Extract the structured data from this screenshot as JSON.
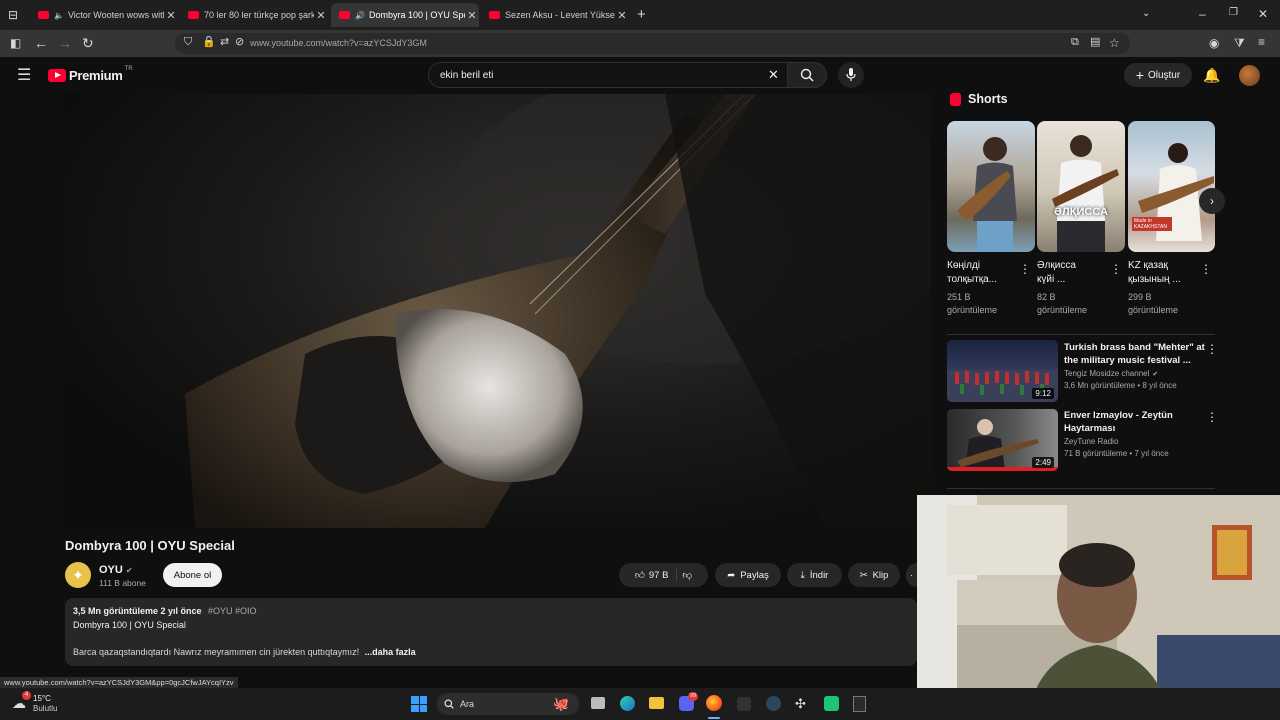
{
  "browser": {
    "tabs": [
      {
        "title": "Victor Wooten wows with h",
        "active": false,
        "audio": true
      },
      {
        "title": "70 ler 80 ler türkçe pop şarkıları",
        "active": false,
        "audio": false
      },
      {
        "title": "Dombyra 100 | OYU Special",
        "active": true,
        "audio": true
      },
      {
        "title": "Sezen Aksu - Levent Yüksel - Se",
        "active": false,
        "audio": false
      }
    ],
    "new_tab_label": "+",
    "url": "www.youtube.com/watch?v=azYCSJdY3GM",
    "status_url": "www.youtube.com/watch?v=azYCSJdY3GM&pp=0gcJCfwJAYcqIYzv"
  },
  "youtube": {
    "logo_text": "Premium",
    "logo_badge": "TR",
    "search_value": "ekin beril eti",
    "create_label": "Oluştur"
  },
  "video": {
    "title": "Dombyra 100 | OYU Special",
    "channel_name": "OYU",
    "subscribers": "111 B abone",
    "subscribe_label": "Abone ol",
    "likes": "97 B",
    "share_label": "Paylaş",
    "download_label": "İndir",
    "clip_label": "Klip",
    "description": {
      "meta": "3,5 Mn görüntüleme  2 yıl önce",
      "tags": "#OYU #OIO",
      "line1": "Dombyra 100 | OYU Special",
      "line2": "Barca qazaqstandıqtardı Nawrız meyramımen cin jürekten quttıqtaymız!",
      "more": "...daha fazla"
    }
  },
  "sidebar": {
    "shorts_heading": "Shorts",
    "shorts": [
      {
        "title_line1": "Көңілді",
        "title_line2": "толқытқа...",
        "views_line1": "251 B",
        "views_line2": "görüntüleme",
        "overlay": ""
      },
      {
        "title_line1": "Әлқисса",
        "title_line2": "күйі ...",
        "views_line1": "82 B",
        "views_line2": "görüntüleme",
        "overlay": "ӘЛҚИССА"
      },
      {
        "title_line1": "KZ қазақ",
        "title_line2": "қызының ...",
        "views_line1": "299 B",
        "views_line2": "görüntüleme",
        "overlay": "Made in KAZAKHSTAN"
      }
    ],
    "videos": [
      {
        "title_line1": "Turkish brass band \"Mehter\" at",
        "title_line2": "the military music festival ...",
        "channel": "Tengiz Mosidze channel",
        "meta": "3,6 Mn görüntüleme • 8 yıl önce",
        "duration": "9:12"
      },
      {
        "title_line1": "Enver Izmaylov - Zeytün",
        "title_line2": "Haytarması",
        "channel": "ZeyTune Radio",
        "meta": "71 B görüntüleme • 7 yıl önce",
        "duration": "2:49"
      }
    ]
  },
  "taskbar": {
    "weather_temp": "15°C",
    "weather_desc": "Bulutlu",
    "weather_badge": "4",
    "search_placeholder": "Ara",
    "discord_badge": "99"
  }
}
